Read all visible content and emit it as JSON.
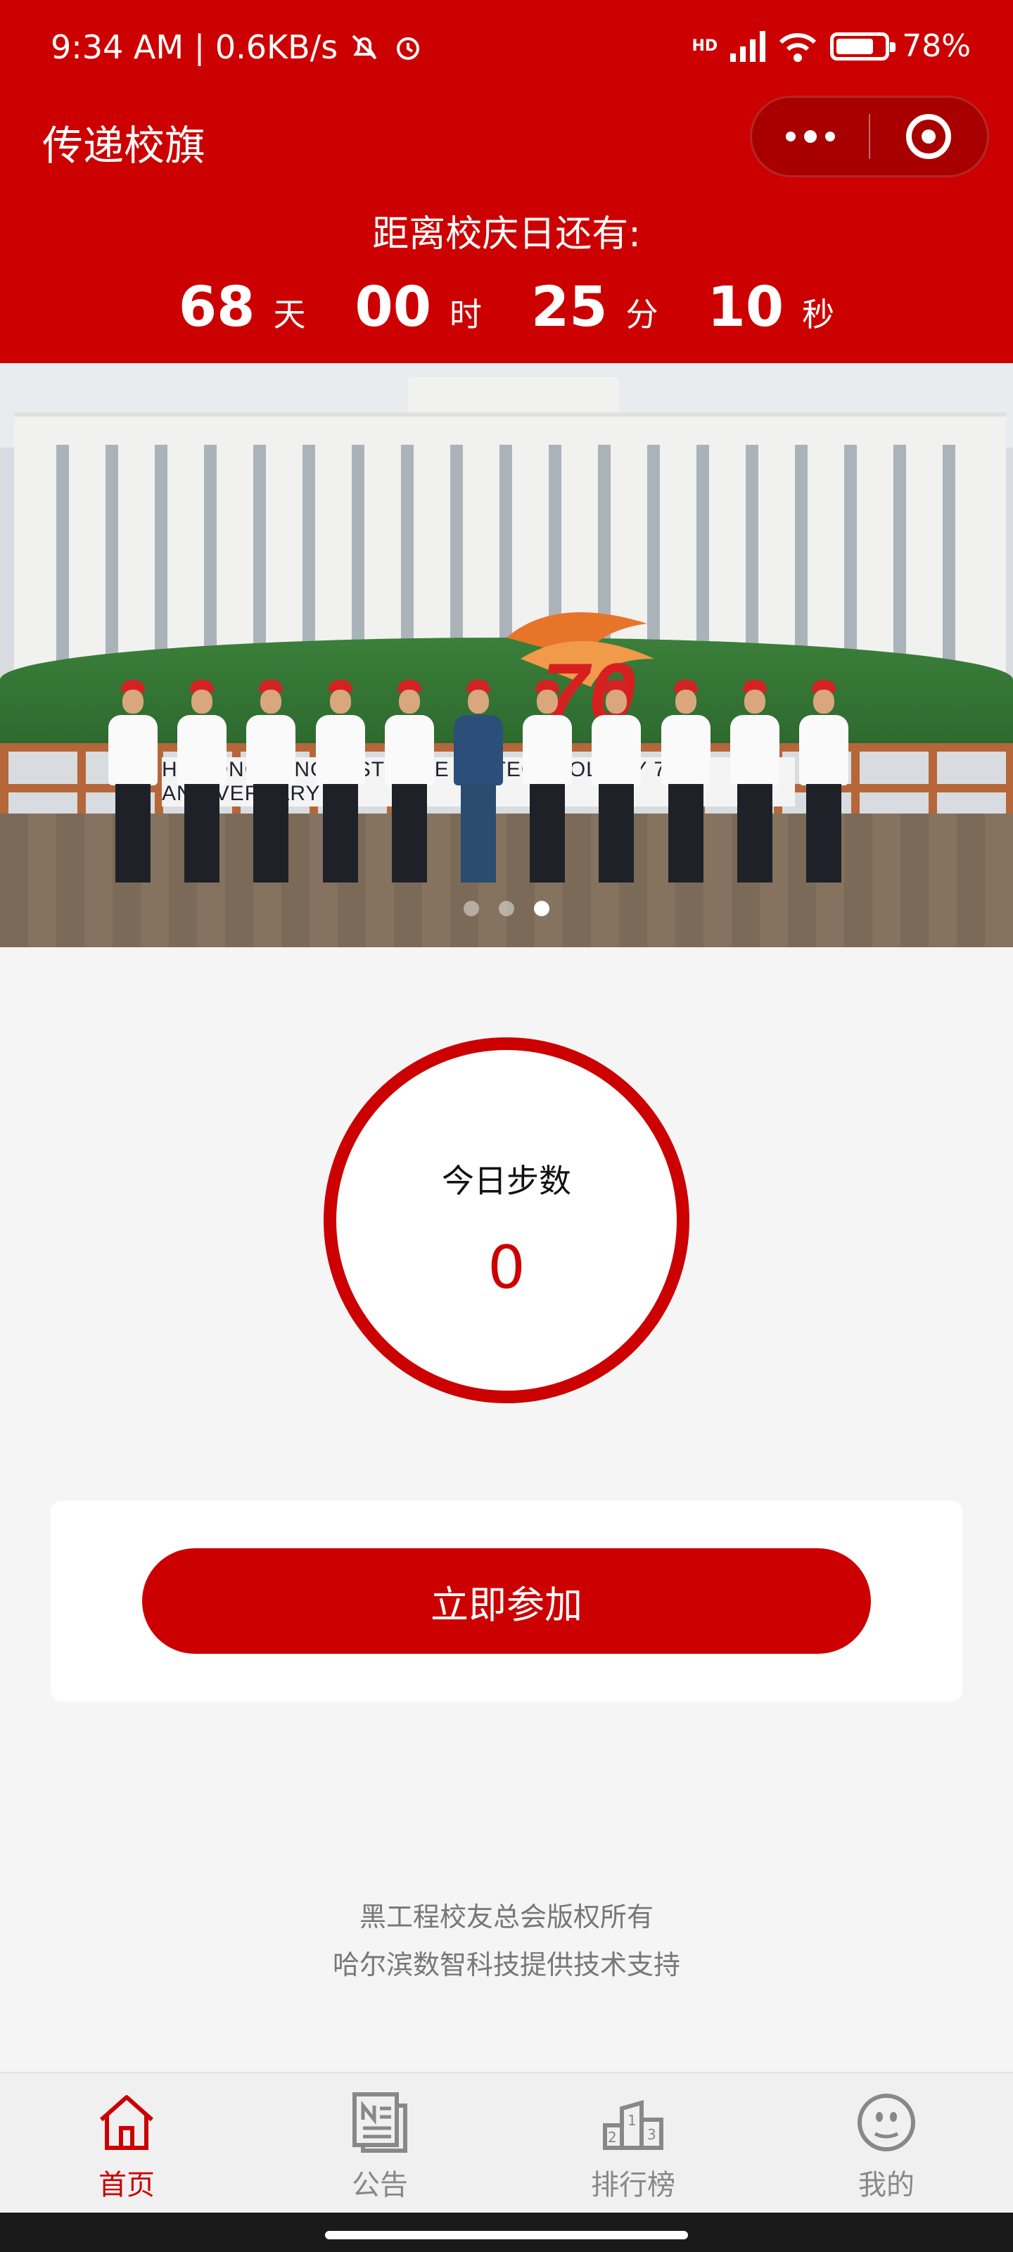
{
  "status_bar": {
    "time_speed": "9:34 AM | 0.6KB/s",
    "network": "HD",
    "battery": "78%"
  },
  "nav": {
    "title": "传递校旗"
  },
  "countdown": {
    "label": "距离校庆日还有:",
    "days": "68",
    "days_unit": "天",
    "hours": "00",
    "hours_unit": "时",
    "minutes": "25",
    "minutes_unit": "分",
    "seconds": "10",
    "seconds_unit": "秒"
  },
  "banner": {
    "sign_text": "HEILONGJIANG INSTITUTE OF TECHNOLOGY 70TH ANNIVERSARY",
    "logo_text": "70",
    "slide_count": 3,
    "active_slide": 3
  },
  "steps": {
    "label": "今日步数",
    "value": "0"
  },
  "join": {
    "label": "立即参加"
  },
  "footer": {
    "line1": "黑工程校友总会版权所有",
    "line2": "哈尔滨数智科技提供技术支持"
  },
  "tabs": [
    {
      "label": "首页",
      "icon": "home-icon",
      "active": true
    },
    {
      "label": "公告",
      "icon": "news-icon",
      "active": false
    },
    {
      "label": "排行榜",
      "icon": "podium-icon",
      "active": false
    },
    {
      "label": "我的",
      "icon": "profile-icon",
      "active": false
    }
  ],
  "colors": {
    "brand": "#cc0000",
    "inactive_tab": "#888888"
  }
}
